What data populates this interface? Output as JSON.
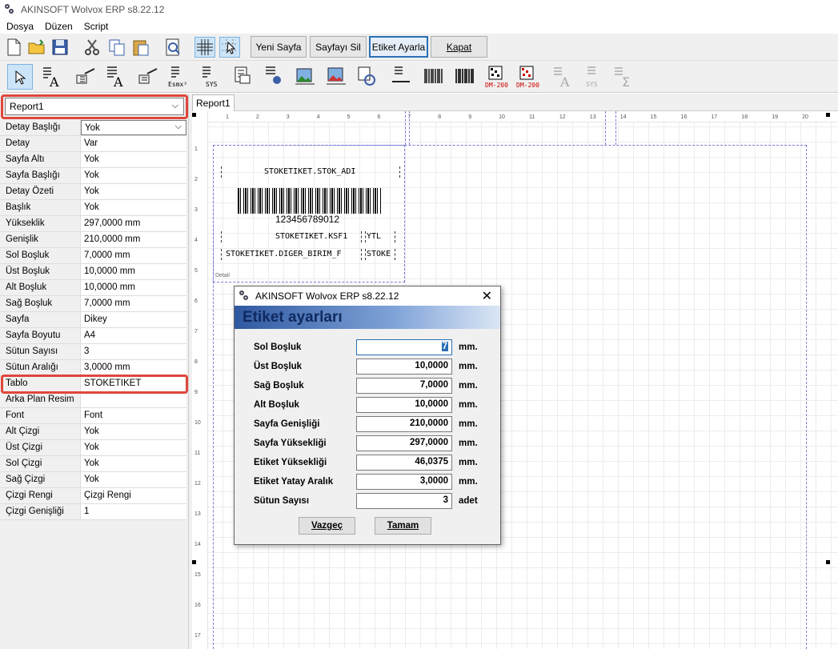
{
  "window": {
    "title": "AKINSOFT Wolvox ERP s8.22.12"
  },
  "menu": [
    "Dosya",
    "Düzen",
    "Script"
  ],
  "toolbar_buttons": {
    "yeni_sayfa": "Yeni Sayfa",
    "sayfayi_sil": "Sayfayı Sil",
    "etiket_ayarla": "Etiket Ayarla",
    "kapat": "Kapat"
  },
  "toolbar2_labels": {
    "esm": "Esmx²",
    "sys": "SYS",
    "dm1": "DM-200",
    "dm2": "DM-200",
    "sys2": "SYS"
  },
  "report_select": {
    "value": "Report1"
  },
  "properties": [
    {
      "key": "Detay Başlığı",
      "value": "Yok"
    },
    {
      "key": "Detay",
      "value": "Var"
    },
    {
      "key": "Sayfa Altı",
      "value": "Yok"
    },
    {
      "key": "Sayfa Başlığı",
      "value": "Yok"
    },
    {
      "key": "Detay Özeti",
      "value": "Yok"
    },
    {
      "key": "Başlık",
      "value": "Yok"
    },
    {
      "key": "Yükseklik",
      "value": "297,0000 mm"
    },
    {
      "key": "Genişlik",
      "value": "210,0000 mm"
    },
    {
      "key": "Sol Boşluk",
      "value": "7,0000 mm"
    },
    {
      "key": "Üst Boşluk",
      "value": "10,0000 mm"
    },
    {
      "key": "Alt Boşluk",
      "value": "10,0000 mm"
    },
    {
      "key": "Sağ Boşluk",
      "value": "7,0000 mm"
    },
    {
      "key": "Sayfa",
      "value": "Dikey"
    },
    {
      "key": "Sayfa Boyutu",
      "value": "A4"
    },
    {
      "key": "Sütun Sayısı",
      "value": "3"
    },
    {
      "key": "Sütun Aralığı",
      "value": "3,0000 mm"
    },
    {
      "key": "Tablo",
      "value": "STOKETIKET"
    },
    {
      "key": "Arka Plan Resim",
      "value": ""
    },
    {
      "key": "Font",
      "value": "Font"
    },
    {
      "key": "Alt Çizgi",
      "value": "Yok"
    },
    {
      "key": "Üst Çizgi",
      "value": "Yok"
    },
    {
      "key": "Sol Çizgi",
      "value": "Yok"
    },
    {
      "key": "Sağ Çizgi",
      "value": "Yok"
    },
    {
      "key": "Çizgi Rengi",
      "value": "Çizgi Rengi"
    },
    {
      "key": "Çizgi Genişliği",
      "value": "1"
    }
  ],
  "tab": {
    "label": "Report1"
  },
  "ruler": {
    "h": [
      "1",
      "2",
      "3",
      "4",
      "5",
      "6",
      "7",
      "8",
      "9",
      "10",
      "11",
      "12",
      "13",
      "14",
      "15",
      "16",
      "17",
      "18",
      "19",
      "20"
    ],
    "v": [
      "1",
      "2",
      "3",
      "4",
      "5",
      "6",
      "7",
      "8",
      "9",
      "10",
      "11",
      "12",
      "13",
      "14",
      "15",
      "16",
      "17"
    ]
  },
  "label_design": {
    "stok_adi": "STOKETIKET.STOK_ADI",
    "barcode_text": "123456789012",
    "ksf": "STOKETIKET.KSF1",
    "ytl": "YTL",
    "diger": "STOKETIKET.DIGER_BIRIM_F",
    "stoke": "STOKE",
    "band": "Detail"
  },
  "dialog": {
    "title": "AKINSOFT Wolvox ERP s8.22.12",
    "heading": "Etiket ayarları",
    "fields": [
      {
        "label": "Sol Boşluk",
        "value": "7",
        "unit": "mm."
      },
      {
        "label": "Üst Boşluk",
        "value": "10,0000",
        "unit": "mm."
      },
      {
        "label": "Sağ Boşluk",
        "value": "7,0000",
        "unit": "mm."
      },
      {
        "label": "Alt Boşluk",
        "value": "10,0000",
        "unit": "mm."
      },
      {
        "label": "Sayfa Genişliği",
        "value": "210,0000",
        "unit": "mm."
      },
      {
        "label": "Sayfa Yüksekliği",
        "value": "297,0000",
        "unit": "mm."
      },
      {
        "label": "Etiket Yüksekliği",
        "value": "46,0375",
        "unit": "mm."
      },
      {
        "label": "Etiket Yatay Aralık",
        "value": "3,0000",
        "unit": "mm."
      },
      {
        "label": "Sütun Sayısı",
        "value": "3",
        "unit": "adet"
      }
    ],
    "cancel": "Vazgeç",
    "ok": "Tamam"
  }
}
